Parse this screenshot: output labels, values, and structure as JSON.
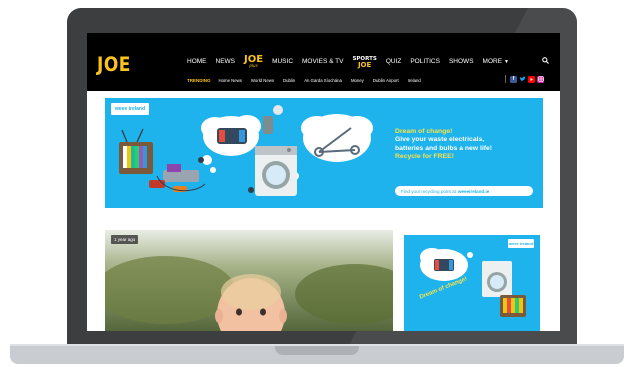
{
  "header": {
    "logo": "JOE",
    "nav": {
      "home": "HOME",
      "news": "NEWS",
      "joe": "JOE",
      "joe_sub": "plus",
      "music": "MUSIC",
      "movies_tv": "MOVIES & TV",
      "sports_top": "SPORTS",
      "sports_bottom": "JOE",
      "quiz": "QUIZ",
      "politics": "POLITICS",
      "shows": "SHOWS",
      "more": "MORE"
    },
    "trending_label": "TRENDING",
    "trending": [
      "Home News",
      "World News",
      "Dublin",
      "An Garda Síochána",
      "Money",
      "Dublin Airport",
      "Ireland"
    ]
  },
  "ad": {
    "brand": "weee ireland",
    "headline": "Dream of change!",
    "line1": "Give your waste electricals,",
    "line2": "batteries and bulbs a new life!",
    "cta": "Recycle for FREE!",
    "search_text": "Find your recycling point at",
    "search_url": "weeeireland.ie"
  },
  "article": {
    "badge": "1 year ago"
  },
  "side_ad": {
    "brand": "weee ireland",
    "headline": "Dream of change!"
  },
  "colors": {
    "brand_yellow": "#f9c31f",
    "ad_blue": "#1eb3ec",
    "ad_yellow": "#f9e24a"
  },
  "icons": {
    "search": "search-icon",
    "social": [
      "facebook-icon",
      "twitter-icon",
      "youtube-icon",
      "instagram-icon"
    ]
  }
}
